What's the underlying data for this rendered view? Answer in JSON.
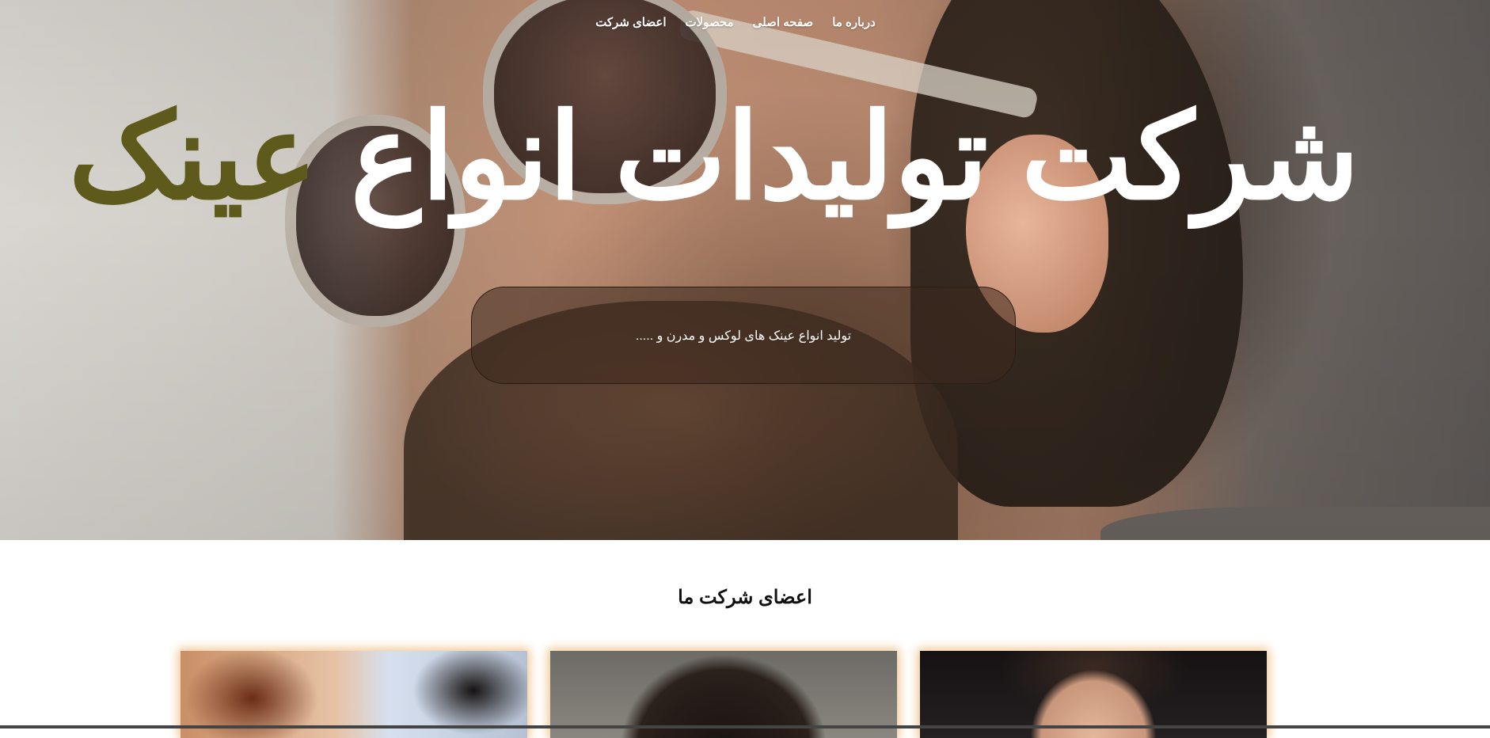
{
  "nav": {
    "items": [
      {
        "label": "درباره ما"
      },
      {
        "label": "صفحه اصلی"
      },
      {
        "label": "محصولات"
      },
      {
        "label": "اعضای شرکت"
      }
    ]
  },
  "hero": {
    "title_main": "شرکت تولیدات انواع ",
    "title_accent": "عینک",
    "subtitle": "تولید انواع عینک های لوکس و مدرن و .....",
    "accent_color": "#5e5a1c"
  },
  "members": {
    "title": "اعضای شرکت ما",
    "cards": [
      {
        "image": "sunglasses-photo"
      },
      {
        "image": "woman-portrait-photo"
      },
      {
        "image": "man-portrait-photo"
      }
    ]
  }
}
